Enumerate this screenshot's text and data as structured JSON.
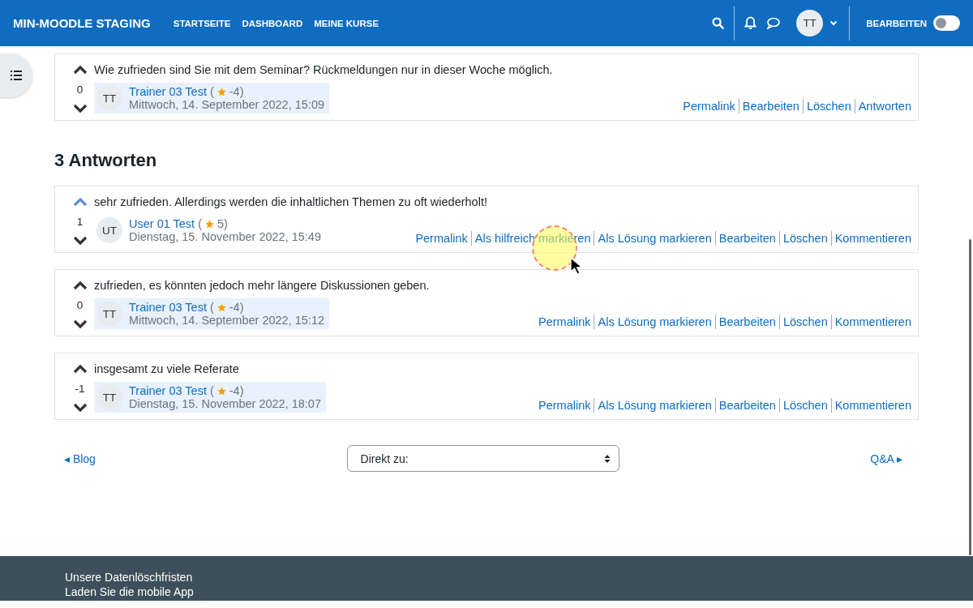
{
  "navbar": {
    "brand": "MIN-MOODLE STAGING",
    "links": [
      "STARTSEITE",
      "DASHBOARD",
      "MEINE KURSE"
    ],
    "user_initials": "TT",
    "edit_label": "BEARBEITEN",
    "edit_mode": false
  },
  "discussion": {
    "text": "Wie zufrieden sind Sie mit dem Seminar? Rückmeldungen nur in dieser Woche möglich.",
    "votes": "0",
    "upvoted": false,
    "initials": "TT",
    "author": "Trainer 03 Test",
    "rating_open": "(",
    "rating": "-4)",
    "date": "Mittwoch, 14. September 2022, 15:09",
    "highlighted": true,
    "actions": [
      "Permalink",
      "Bearbeiten",
      "Löschen",
      "Antworten"
    ]
  },
  "replies_heading": "3 Antworten",
  "replies": [
    {
      "text": "sehr zufrieden. Allerdings werden die inhaltlichen Themen zu oft wiederholt!",
      "votes": "1",
      "upvoted": true,
      "initials": "UT",
      "author": "User 01 Test",
      "rating_open": "(",
      "rating": "5)",
      "date": "Dienstag, 15. November 2022, 15:49",
      "highlighted": false,
      "actions": [
        "Permalink",
        "Als hilfreich markieren",
        "Als Lösung markieren",
        "Bearbeiten",
        "Löschen",
        "Kommentieren"
      ]
    },
    {
      "text": "zufrieden, es könnten jedoch mehr längere Diskussionen geben.",
      "votes": "0",
      "upvoted": false,
      "initials": "TT",
      "author": "Trainer 03 Test",
      "rating_open": "(",
      "rating": "-4)",
      "date": "Mittwoch, 14. September 2022, 15:12",
      "highlighted": true,
      "actions": [
        "Permalink",
        "Als Lösung markieren",
        "Bearbeiten",
        "Löschen",
        "Kommentieren"
      ]
    },
    {
      "text": "insgesamt zu viele Referate",
      "votes": "-1",
      "upvoted": false,
      "initials": "TT",
      "author": "Trainer 03 Test",
      "rating_open": "(",
      "rating": "-4)",
      "date": "Dienstag, 15. November 2022, 18:07",
      "highlighted": true,
      "actions": [
        "Permalink",
        "Als Lösung markieren",
        "Bearbeiten",
        "Löschen",
        "Kommentieren"
      ]
    }
  ],
  "navigation": {
    "previous": "◂ Blog",
    "jump_placeholder": "Direkt zu:",
    "next": "Q&A ▸"
  },
  "footer": {
    "links": [
      "Unsere Datenlöschfristen",
      "Laden Sie die mobile App"
    ]
  }
}
